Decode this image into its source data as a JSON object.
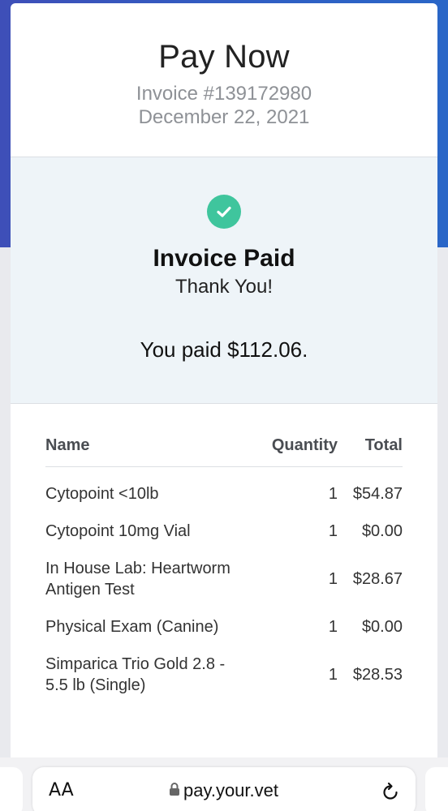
{
  "header": {
    "title": "Pay Now",
    "invoice_number": "Invoice #139172980",
    "date": "December 22, 2021"
  },
  "status": {
    "icon": "check-circle-icon",
    "heading": "Invoice Paid",
    "thanks": "Thank You!",
    "amount_text": "You paid $112.06.",
    "accent_color": "#3fc59d"
  },
  "table": {
    "columns": {
      "name": "Name",
      "quantity": "Quantity",
      "total": "Total"
    },
    "rows": [
      {
        "name": "Cytopoint <10lb",
        "quantity": "1",
        "total": "$54.87"
      },
      {
        "name": "Cytopoint 10mg Vial",
        "quantity": "1",
        "total": "$0.00"
      },
      {
        "name": "In House Lab: Heartworm Antigen Test",
        "quantity": "1",
        "total": "$28.67"
      },
      {
        "name": "Physical Exam (Canine)",
        "quantity": "1",
        "total": "$0.00"
      },
      {
        "name": "Simparica Trio Gold 2.8 - 5.5 lb (Single)",
        "quantity": "1",
        "total": "$28.53"
      }
    ]
  },
  "browser": {
    "text_size_label": "AA",
    "url": "pay.your.vet",
    "lock_icon": "lock-icon",
    "reload_icon": "reload-icon"
  }
}
